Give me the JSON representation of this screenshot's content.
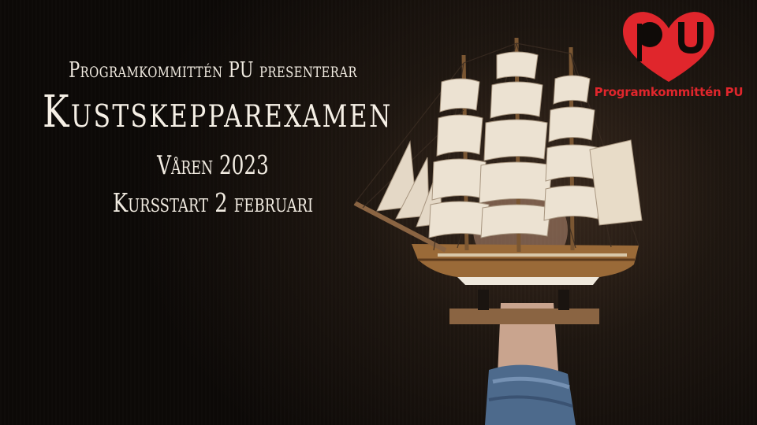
{
  "banner": {
    "presenter": "Programkommittén PU presenterar",
    "title": "Kustskepparexamen",
    "season": "Våren 2023",
    "course_start": "Kursstart 2 februari"
  },
  "logo": {
    "monogram": "PU",
    "name": "Programkommittén PU",
    "color": "#e0262c"
  },
  "photo": {
    "icon": "sailing-ship-model-icon"
  },
  "colors": {
    "text": "#f3ece2",
    "background": "#1e1610"
  }
}
